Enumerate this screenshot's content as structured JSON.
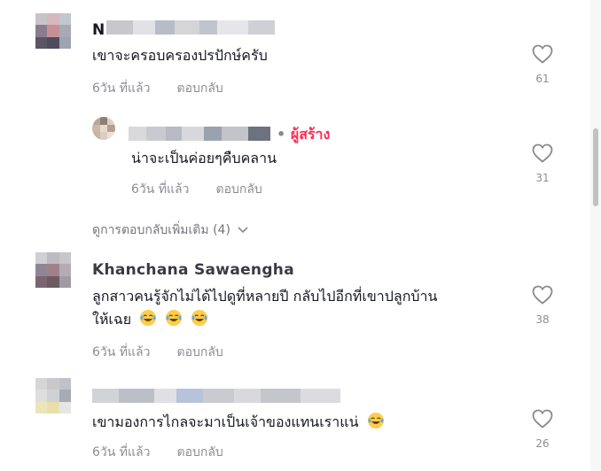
{
  "comments": [
    {
      "user": "N",
      "text": "เขาจะครอบครองปรปักษ์ครับ",
      "time": "6วัน ที่แล้ว",
      "reply": "ตอบกลับ",
      "likes": "61"
    },
    {
      "user": "",
      "creator_badge": "ผู้สร้าง",
      "text": "น่าจะเป็นค่อยๆคืบคลาน",
      "time": "6วัน ที่แล้ว",
      "reply": "ตอบกลับ",
      "likes": "31"
    },
    {
      "user": "Khanchana Sawaengha",
      "text_line1": "ลูกสาวคนรู้จักไม่ได้ไปดูที่หลายปี กลับไปอีกที่เขาปลูกบ้าน",
      "text_line2": "ให้เฉย",
      "time": "6วัน ที่แล้ว",
      "reply": "ตอบกลับ",
      "likes": "38"
    },
    {
      "user": "",
      "text": "เขามองการไกลจะมาเป็นเจ้าของแทนเราแน่",
      "time": "6วัน ที่แล้ว",
      "reply": "ตอบกลับ",
      "likes": "26"
    }
  ],
  "view_more": "ดูการตอบกลับเพิ่มเติม (4)",
  "icons": {
    "like": "heart-outline-icon",
    "chevron": "chevron-down-icon",
    "emoji": "laughing-emoji-icon"
  },
  "colors": {
    "accent": "#fe2c55",
    "text": "#161823",
    "muted": "#8a8b91"
  }
}
